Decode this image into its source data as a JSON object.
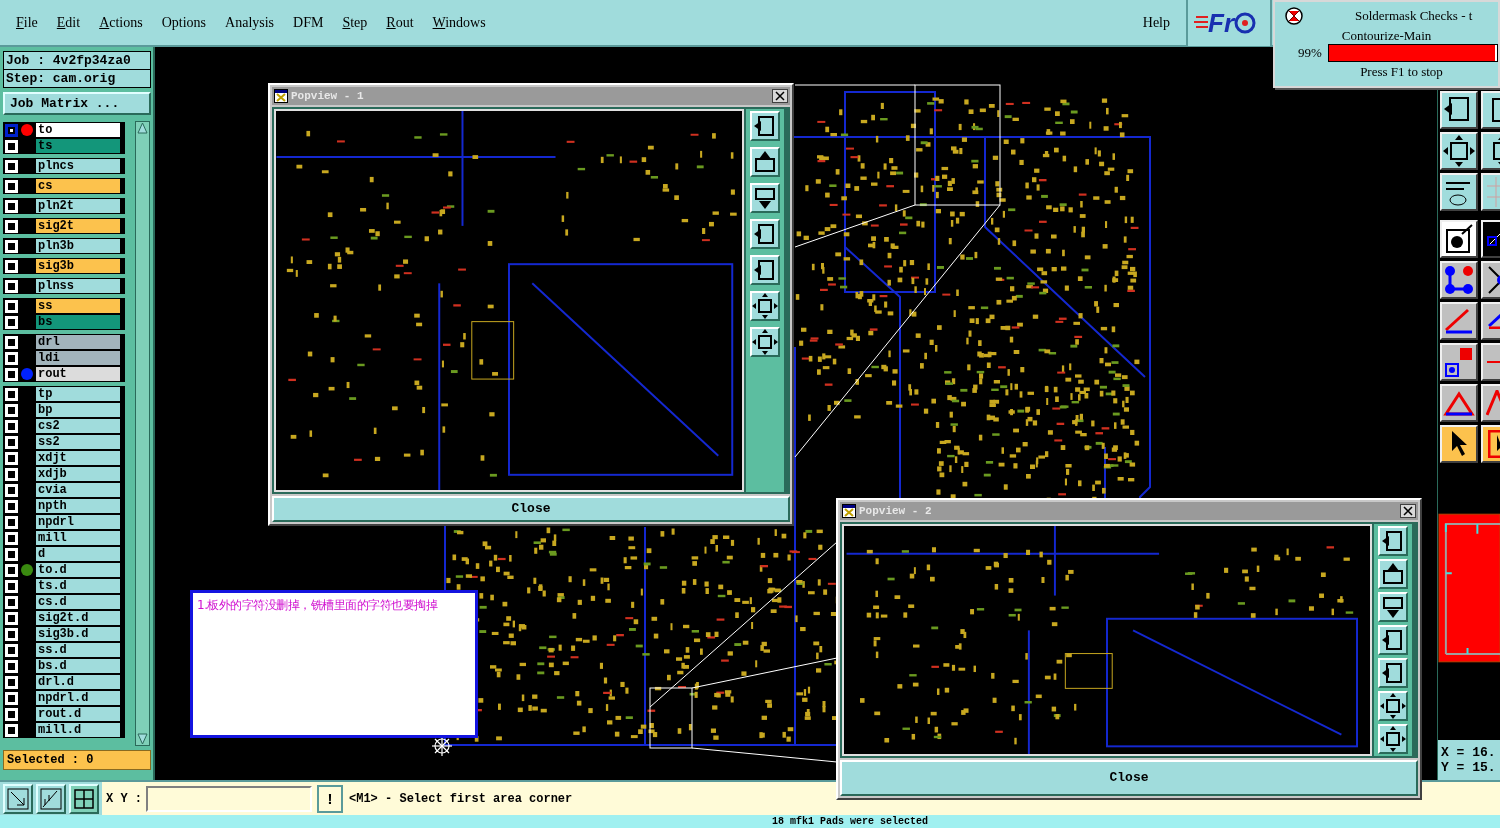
{
  "menu": [
    {
      "label": "File",
      "underlined": true
    },
    {
      "label": "Edit",
      "underlined": true
    },
    {
      "label": "Actions",
      "underlined": true
    },
    {
      "label": "Options",
      "underlined": false
    },
    {
      "label": "Analysis",
      "underlined": false
    },
    {
      "label": "DFM",
      "underlined": false
    },
    {
      "label": "Step",
      "underlined": true
    },
    {
      "label": "Rout",
      "underlined": true
    },
    {
      "label": "Windows",
      "underlined": true
    }
  ],
  "help": "Help",
  "logo": {
    "text": "Fr"
  },
  "progress": {
    "title": "Soldermask Checks - t",
    "step": "Contourize-Main",
    "percent": "99%",
    "level": 0.99,
    "hint": "Press F1 to stop"
  },
  "job_panel": {
    "job": "Job : 4v2fp34za0",
    "step": "Step: cam.orig",
    "matrix_button": "Job Matrix ...",
    "layer_groups": [
      [
        {
          "name": "to",
          "kind": "silk_screen",
          "selected": true,
          "color": "#ff0000"
        },
        {
          "name": "ts",
          "kind": "solder_mask",
          "selected": false
        }
      ],
      [
        {
          "name": "plncs",
          "kind": "power_ground",
          "selected": false
        }
      ],
      [
        {
          "name": "cs",
          "kind": "signal",
          "selected": false
        }
      ],
      [
        {
          "name": "pln2t",
          "kind": "power_ground",
          "selected": false
        }
      ],
      [
        {
          "name": "sig2t",
          "kind": "signal",
          "selected": false
        }
      ],
      [
        {
          "name": "pln3b",
          "kind": "power_ground",
          "selected": false
        }
      ],
      [
        {
          "name": "sig3b",
          "kind": "signal",
          "selected": false
        }
      ],
      [
        {
          "name": "plnss",
          "kind": "power_ground",
          "selected": false
        }
      ],
      [
        {
          "name": "ss",
          "kind": "signal",
          "selected": false
        },
        {
          "name": "bs",
          "kind": "solder_mask",
          "selected": false
        }
      ],
      [
        {
          "name": "drl",
          "kind": "drill",
          "selected": false
        },
        {
          "name": "ldi",
          "kind": "drill",
          "selected": false
        },
        {
          "name": "rout",
          "kind": "rout",
          "selected": false,
          "color": "#0022ff"
        }
      ],
      [
        {
          "name": "tp",
          "kind": "document",
          "selected": false
        },
        {
          "name": "bp",
          "kind": "document",
          "selected": false
        },
        {
          "name": "cs2",
          "kind": "document",
          "selected": false
        },
        {
          "name": "ss2",
          "kind": "document",
          "selected": false
        },
        {
          "name": "xdjt",
          "kind": "document",
          "selected": false
        },
        {
          "name": "xdjb",
          "kind": "document",
          "selected": false
        },
        {
          "name": "cvia",
          "kind": "document",
          "selected": false
        },
        {
          "name": "npth",
          "kind": "document",
          "selected": false
        },
        {
          "name": "npdrl",
          "kind": "document",
          "selected": false
        },
        {
          "name": "mill",
          "kind": "document",
          "selected": false
        },
        {
          "name": "d",
          "kind": "document",
          "selected": false
        },
        {
          "name": "to.d",
          "kind": "document",
          "selected": false,
          "color": "#3a8a10"
        },
        {
          "name": "ts.d",
          "kind": "document",
          "selected": false
        },
        {
          "name": "cs.d",
          "kind": "document",
          "selected": false
        },
        {
          "name": "sig2t.d",
          "kind": "document",
          "selected": false
        },
        {
          "name": "sig3b.d",
          "kind": "document",
          "selected": false
        },
        {
          "name": "ss.d",
          "kind": "document",
          "selected": false
        },
        {
          "name": "bs.d",
          "kind": "document",
          "selected": false
        },
        {
          "name": "drl.d",
          "kind": "document",
          "selected": false
        },
        {
          "name": "npdrl.d",
          "kind": "document",
          "selected": false
        },
        {
          "name": "rout.d",
          "kind": "document",
          "selected": false
        },
        {
          "name": "mill.d",
          "kind": "document",
          "selected": false
        }
      ]
    ],
    "selected_count": "Selected : 0"
  },
  "popviews": [
    {
      "title": "Popview - 1",
      "close": "Close"
    },
    {
      "title": "Popview - 2",
      "close": "Close"
    }
  ],
  "note": "1.板外的字符没删掉，铣槽里面的字符也要掏掉",
  "coordinates": [
    "X = 16.",
    "Y = 15."
  ],
  "command_bar": {
    "xy_label": "X Y :",
    "alert": "!",
    "prompt": "<M1> - Select first area corner"
  },
  "status_bar": "18 mfk1 Pads were selected"
}
